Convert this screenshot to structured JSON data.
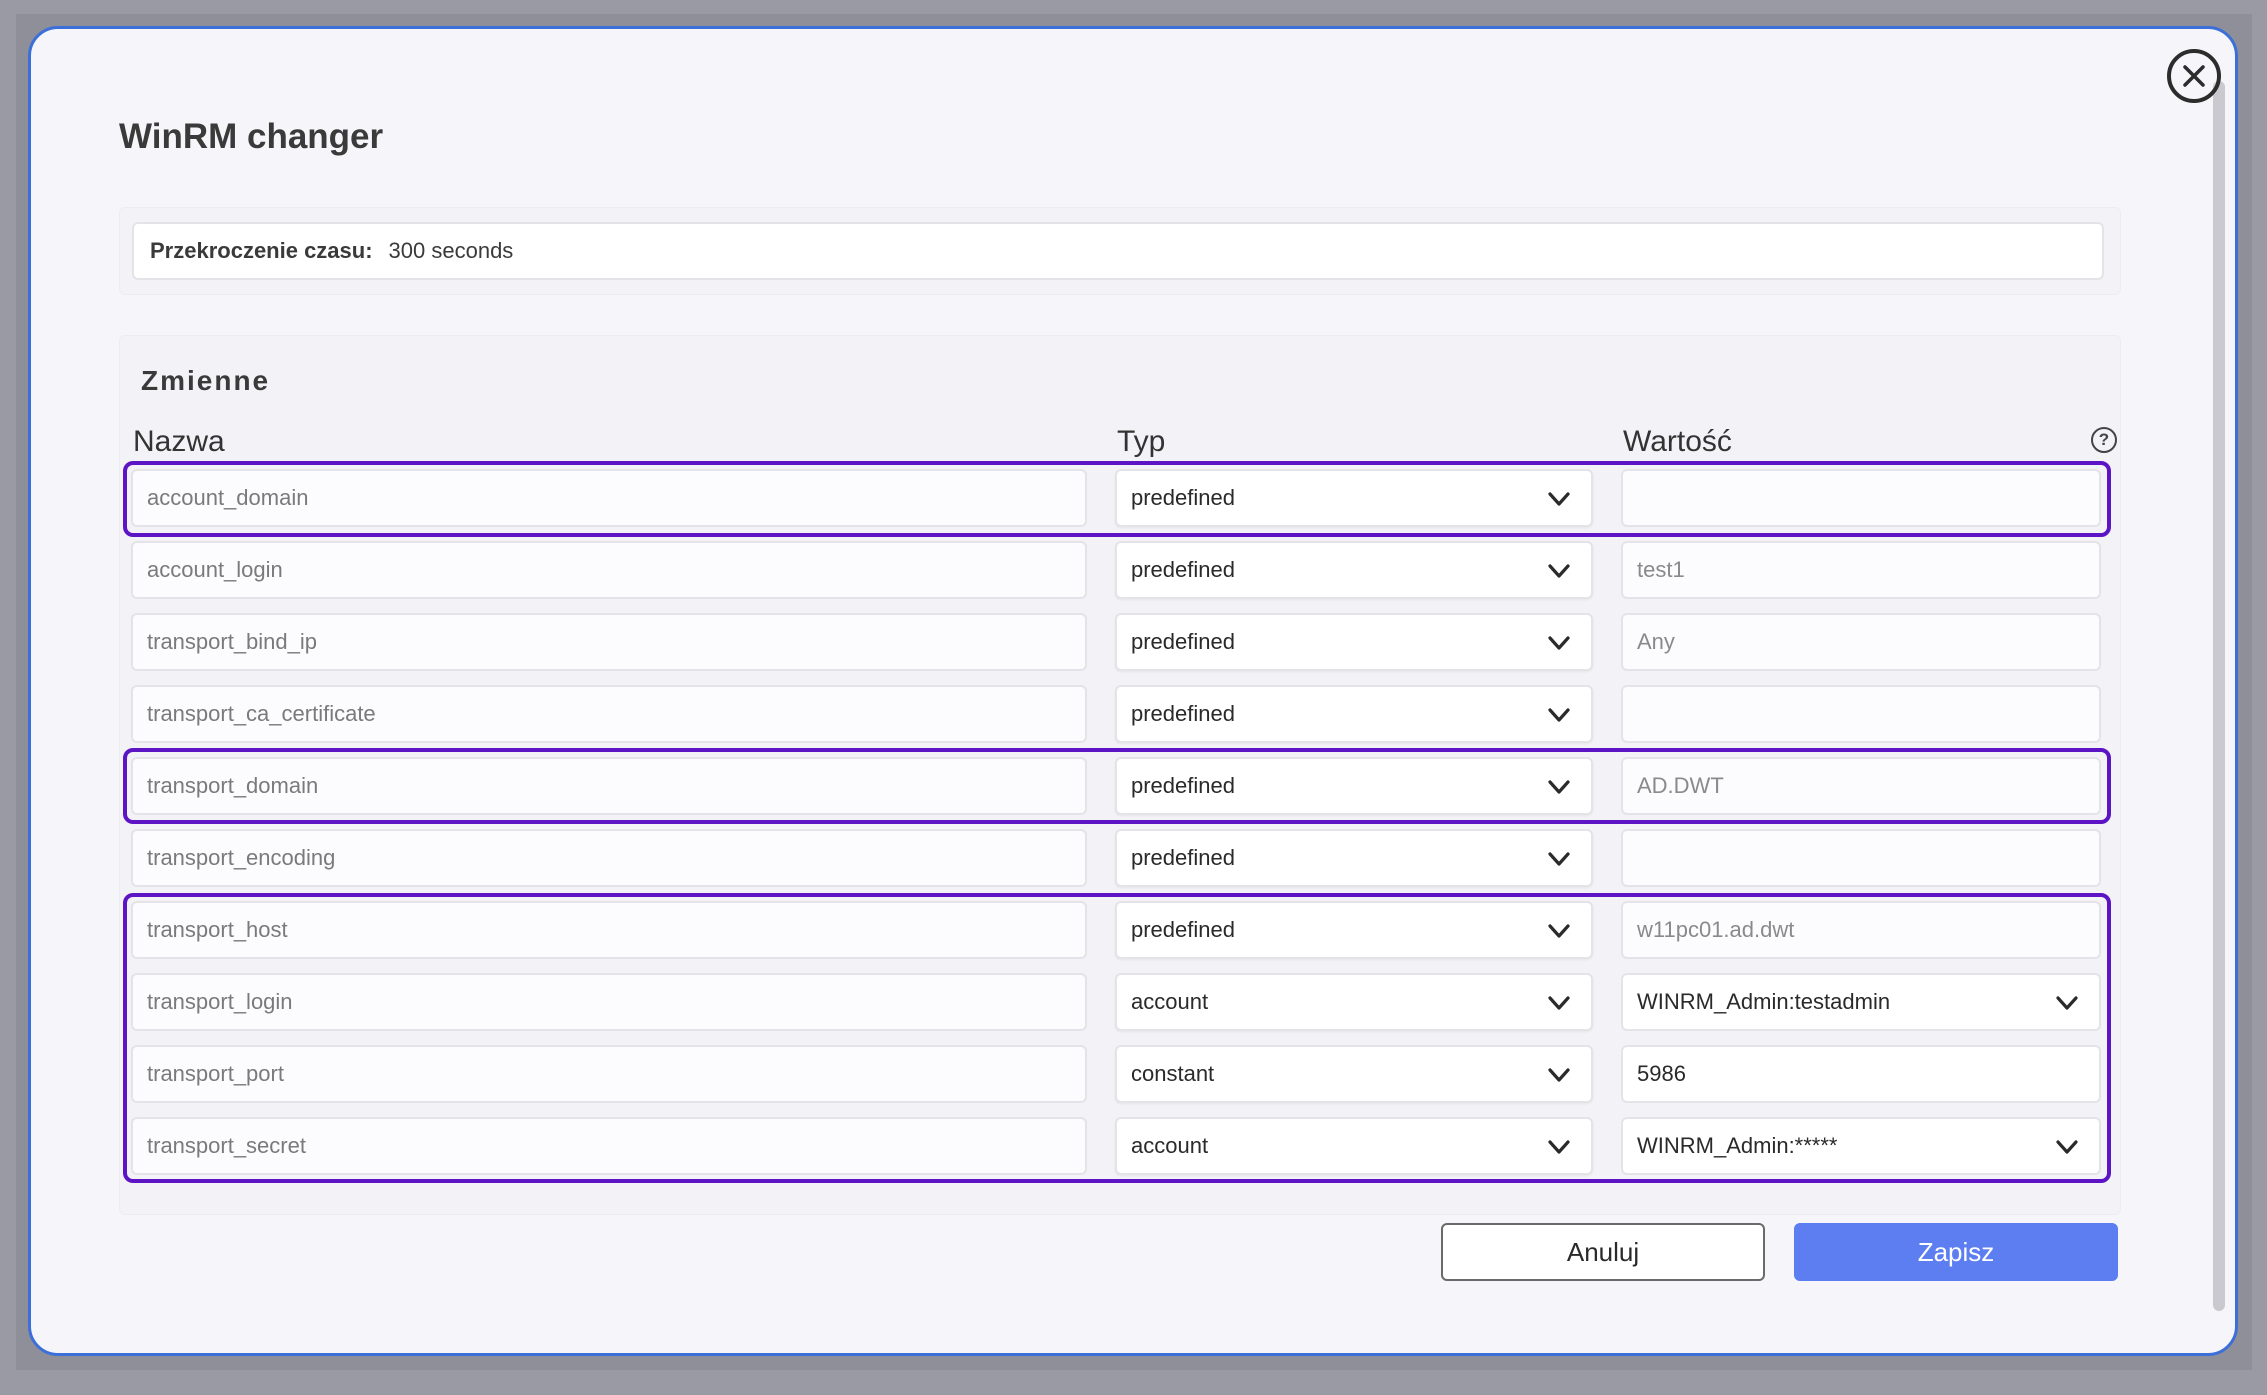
{
  "dialog": {
    "title": "WinRM changer",
    "close_icon": "close-circle-icon"
  },
  "timeout": {
    "label": "Przekroczenie czasu:",
    "value": "300 seconds"
  },
  "variables": {
    "title": "Zmienne",
    "headers": {
      "name": "Nazwa",
      "type": "Typ",
      "value": "Wartość"
    },
    "help_icon": "?",
    "rows": [
      {
        "name": "account_domain",
        "type": "predefined",
        "value": ""
      },
      {
        "name": "account_login",
        "type": "predefined",
        "value": "test1"
      },
      {
        "name": "transport_bind_ip",
        "type": "predefined",
        "value": "Any"
      },
      {
        "name": "transport_ca_certificate",
        "type": "predefined",
        "value": ""
      },
      {
        "name": "transport_domain",
        "type": "predefined",
        "value": "AD.DWT"
      },
      {
        "name": "transport_encoding",
        "type": "predefined",
        "value": ""
      },
      {
        "name": "transport_host",
        "type": "predefined",
        "value": "w11pc01.ad.dwt"
      },
      {
        "name": "transport_login",
        "type": "account",
        "value": "WINRM_Admin:testadmin"
      },
      {
        "name": "transport_port",
        "type": "constant",
        "value": "5986"
      },
      {
        "name": "transport_secret",
        "type": "account",
        "value": "WINRM_Admin:*****"
      }
    ]
  },
  "buttons": {
    "cancel": "Anuluj",
    "save": "Zapisz"
  },
  "colors": {
    "highlight": "#5d14c4",
    "primary": "#5c7ef0",
    "dialog_border": "#3d6fd8"
  }
}
